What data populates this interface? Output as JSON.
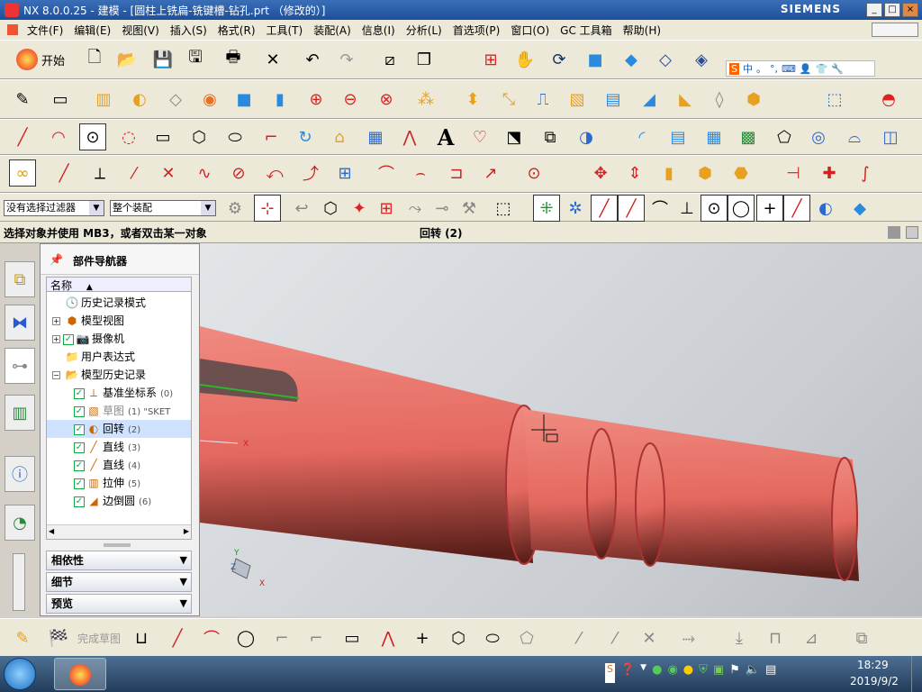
{
  "window": {
    "title": "NX 8.0.0.25 - 建模 - [圆柱上铣扁-铣键槽-钻孔.prt （修改的）]",
    "brand": "SIEMENS",
    "controls": [
      "_",
      "□",
      "×"
    ]
  },
  "menu": [
    "文件(F)",
    "编辑(E)",
    "视图(V)",
    "插入(S)",
    "格式(R)",
    "工具(T)",
    "装配(A)",
    "信息(I)",
    "分析(L)",
    "首选项(P)",
    "窗口(O)",
    "GC 工具箱",
    "帮助(H)"
  ],
  "toolbar_start": "开始",
  "ime_icons": [
    "S",
    "中",
    "。",
    "°,",
    "键盘",
    "人",
    "T恤",
    "扳手"
  ],
  "selection_bar": {
    "filter": "没有选择过滤器",
    "scope": "整个装配"
  },
  "status": {
    "prompt": "选择对象并使用 MB3，或者双击某一对象",
    "message": "回转 (2)"
  },
  "navigator": {
    "title": "部件导航器",
    "column": "名称",
    "items": [
      {
        "label": "历史记录模式",
        "indent": 1,
        "icon": "clock-icon",
        "checked": null
      },
      {
        "label": "模型视图",
        "indent": 0,
        "icon": "views-icon",
        "checked": null,
        "expand": "+"
      },
      {
        "label": "摄像机",
        "indent": 0,
        "icon": "camera-icon",
        "checked": true,
        "expand": "+"
      },
      {
        "label": "用户表达式",
        "indent": 1,
        "icon": "folder-icon",
        "checked": null
      },
      {
        "label": "模型历史记录",
        "indent": 0,
        "icon": "folder-open-icon",
        "checked": null,
        "expand": "-"
      },
      {
        "label": "基准坐标系",
        "suffix": "(0)",
        "indent": 2,
        "icon": "datum-csys-icon",
        "checked": true
      },
      {
        "label": "草图",
        "suffix": "(1) \"SKET",
        "indent": 2,
        "icon": "sketch-icon",
        "checked": true,
        "dim": true
      },
      {
        "label": "回转",
        "suffix": "(2)",
        "indent": 2,
        "icon": "revolve-icon",
        "checked": true,
        "selected": true
      },
      {
        "label": "直线",
        "suffix": "(3)",
        "indent": 2,
        "icon": "line-icon",
        "checked": true
      },
      {
        "label": "直线",
        "suffix": "(4)",
        "indent": 2,
        "icon": "line-icon",
        "checked": true
      },
      {
        "label": "拉伸",
        "suffix": "(5)",
        "indent": 2,
        "icon": "extrude-icon",
        "checked": true
      },
      {
        "label": "边倒圆",
        "suffix": "(6)",
        "indent": 2,
        "icon": "edge-blend-icon",
        "checked": true
      }
    ],
    "panels": [
      "相依性",
      "细节",
      "预览"
    ]
  },
  "viewport": {
    "part_color": "#e4685f",
    "triad_labels": [
      "Y",
      "Z",
      "X"
    ]
  },
  "sketch_bar": {
    "finish_label": "完成草图"
  },
  "taskbar": {
    "time": "18:29",
    "date": "2019/9/2"
  }
}
